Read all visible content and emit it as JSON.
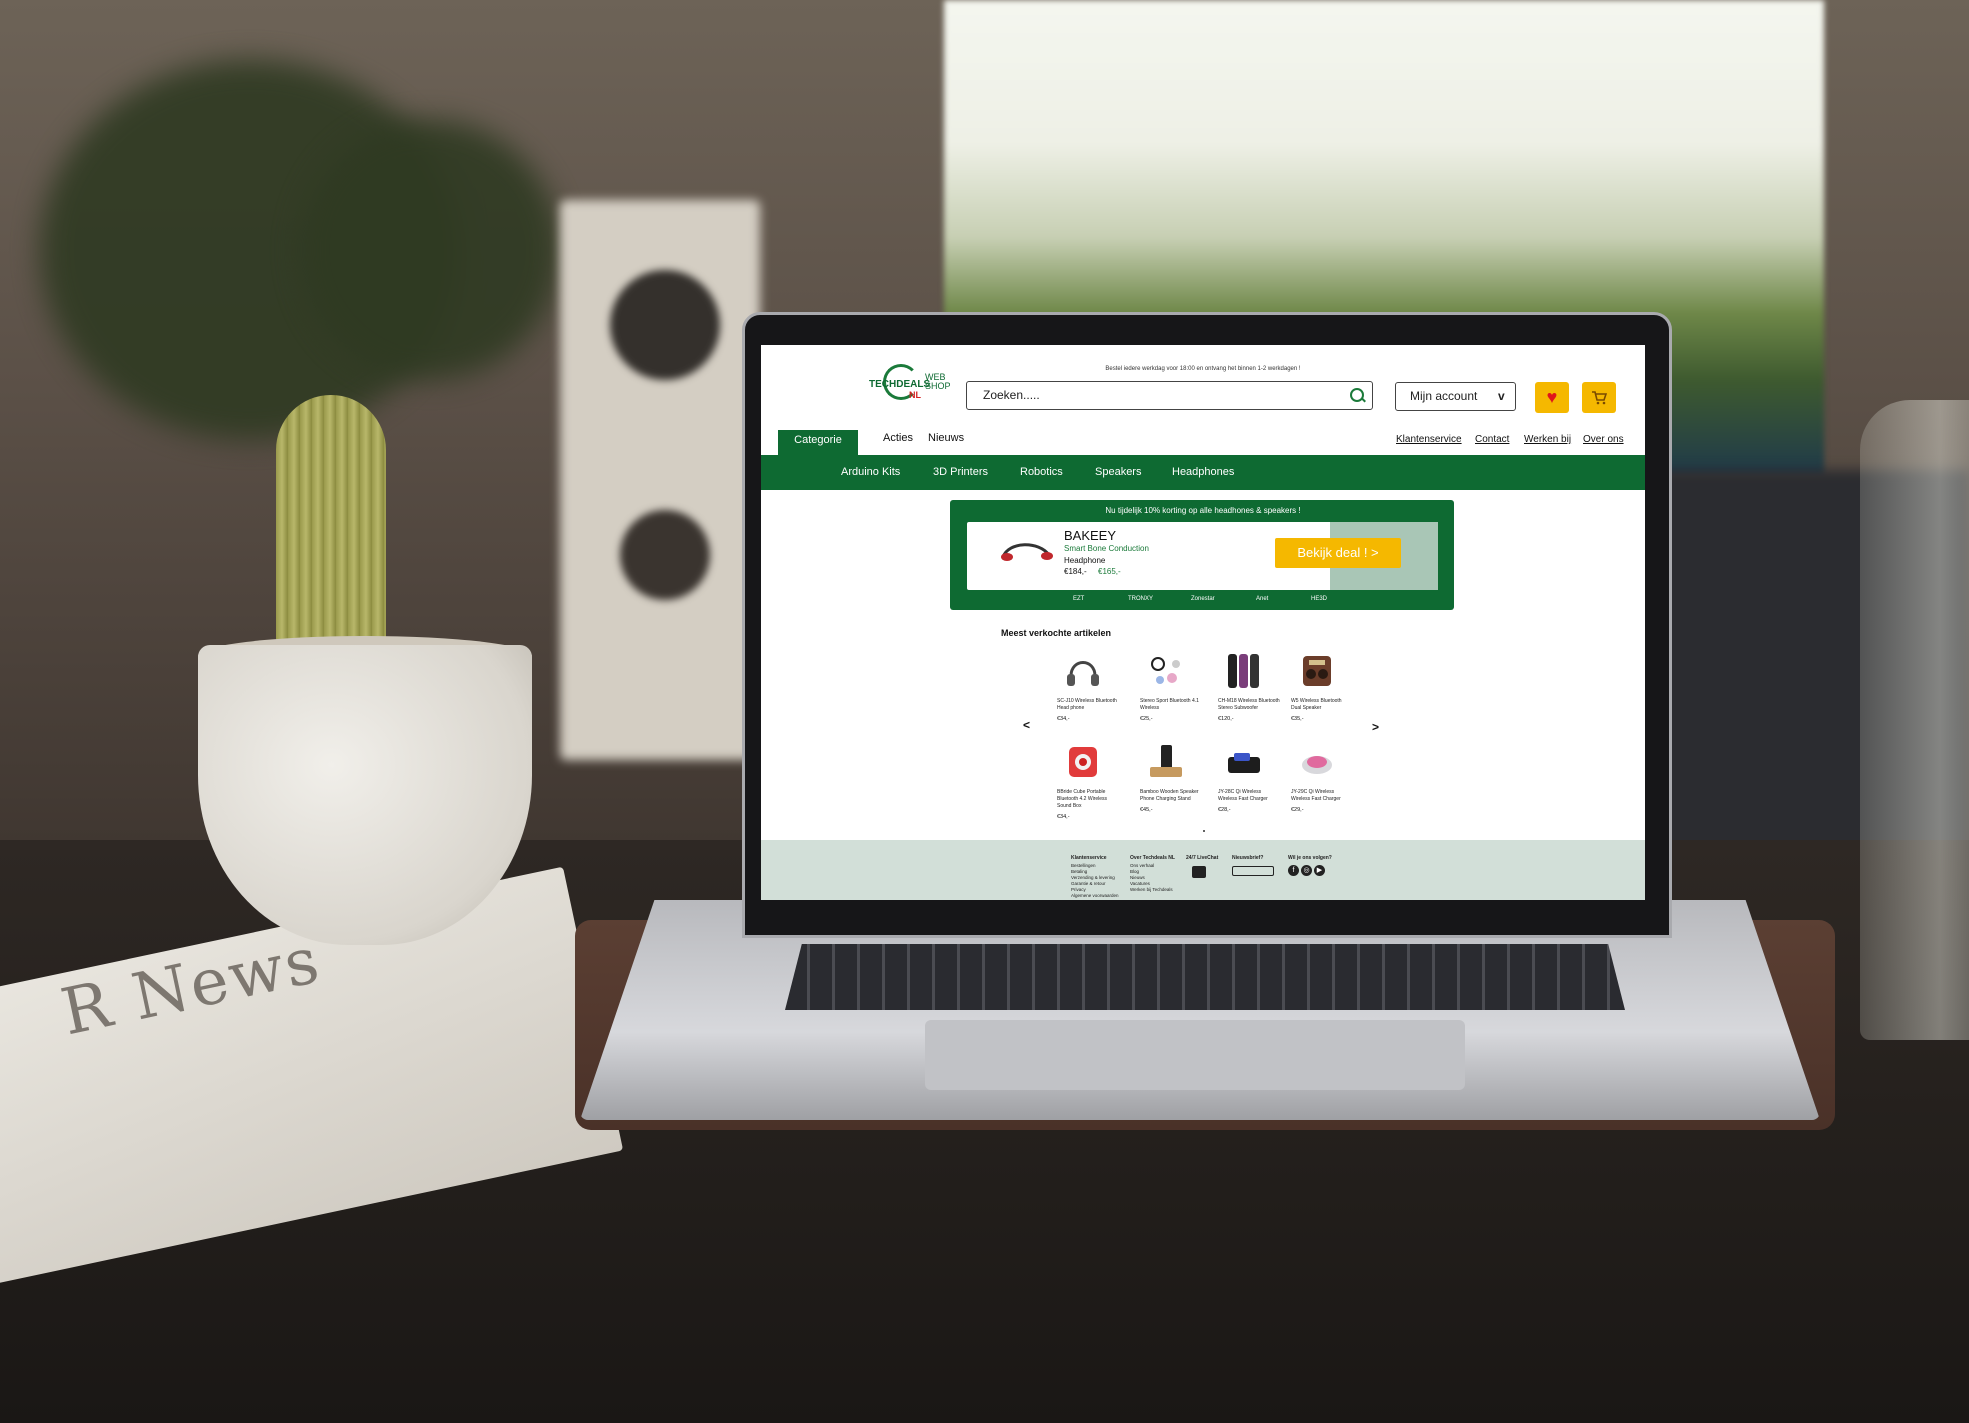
{
  "site": {
    "notice": "Bestel iedere werkdag voor 18:00 en ontvang het binnen 1-2 werkdagen !",
    "logo": {
      "word_a": "TECHDEALS",
      "word_nl": "NL",
      "word_b1": "WEB",
      "word_b2": "SHOP"
    },
    "search": {
      "placeholder": "Zoeken....."
    },
    "account": {
      "label": "Mijn account",
      "chevron": "v"
    },
    "icons": {
      "wishlist": "heart-icon",
      "cart": "cart-icon"
    }
  },
  "nav": {
    "active_tab": "Categorie",
    "tabs": [
      "Acties",
      "Nieuws"
    ],
    "right_links": [
      "Klantenservice",
      "Contact",
      "Werken bij",
      "Over ons"
    ],
    "categories": [
      "Arduino Kits",
      "3D Printers",
      "Robotics",
      "Speakers",
      "Headphones"
    ]
  },
  "promo": {
    "title": "Nu tijdelijk 10% korting op alle headhones & speakers !",
    "brand": "BAKEEY",
    "subtitle": "Smart Bone Conduction",
    "subtitle2": "Headphone",
    "old_price": "€184,-",
    "new_price": "€165,-",
    "button": "Bekijk deal !  >",
    "brands": [
      "EZT",
      "TRONXY",
      "Zonestar",
      "Anet",
      "HE3D"
    ]
  },
  "bestsellers": {
    "title": "Meest verkochte artikelen",
    "prev": "<",
    "next": ">",
    "products": [
      {
        "name": "SC-J10 Wireless Bluetooth Head phone",
        "price": "€34,-",
        "icon": "headphone-icon"
      },
      {
        "name": "Stereo Sport Bluetooth 4.1 Wireless",
        "price": "€25,-",
        "icon": "earbuds-icon"
      },
      {
        "name": "CH-M18 Wireless Bluetooth Stereo Subwoofer",
        "price": "€120,-",
        "icon": "speaker-column-icon"
      },
      {
        "name": "W5 Wireless Bluetooth Dual Speaker",
        "price": "€35,-",
        "icon": "retro-speaker-icon"
      },
      {
        "name": "BBride Cube Portable Bluetooth 4.2 Wireless Sound Box",
        "price": "€34,-",
        "icon": "cube-speaker-icon"
      },
      {
        "name": "Bamboo Wooden Speaker Phone Charging Stand",
        "price": "€45,-",
        "icon": "phone-stand-icon"
      },
      {
        "name": "JY-28C Qi Wireless Wireless Fast Charger",
        "price": "€28,-",
        "icon": "charger-pad-icon"
      },
      {
        "name": "JY-29C Qi Wireless Wireless Fast Charger",
        "price": "€29,-",
        "icon": "charger-disc-icon"
      }
    ]
  },
  "footer": {
    "klantenservice": {
      "title": "Klantenservice",
      "links": [
        "Bestellingen",
        "Betaling",
        "Verzending & levering",
        "Garantie & retour",
        "Privacy",
        "Algemene voorwaarden"
      ]
    },
    "over": {
      "title": "Over Techdeals NL",
      "links": [
        "Ons verhaal",
        "Blog",
        "Nieuws",
        "Vacatures",
        "Werken bij Techdeals"
      ]
    },
    "livechat": {
      "title": "24/7 LiveChat"
    },
    "newsletter": {
      "title": "Nieuwsbrief?",
      "placeholder": "Emailadres"
    },
    "social": {
      "title": "Wil je ons volgen?",
      "icons": [
        "facebook-icon",
        "instagram-icon",
        "youtube-icon"
      ]
    }
  },
  "photo": {
    "newspaper_headline": "R News"
  }
}
